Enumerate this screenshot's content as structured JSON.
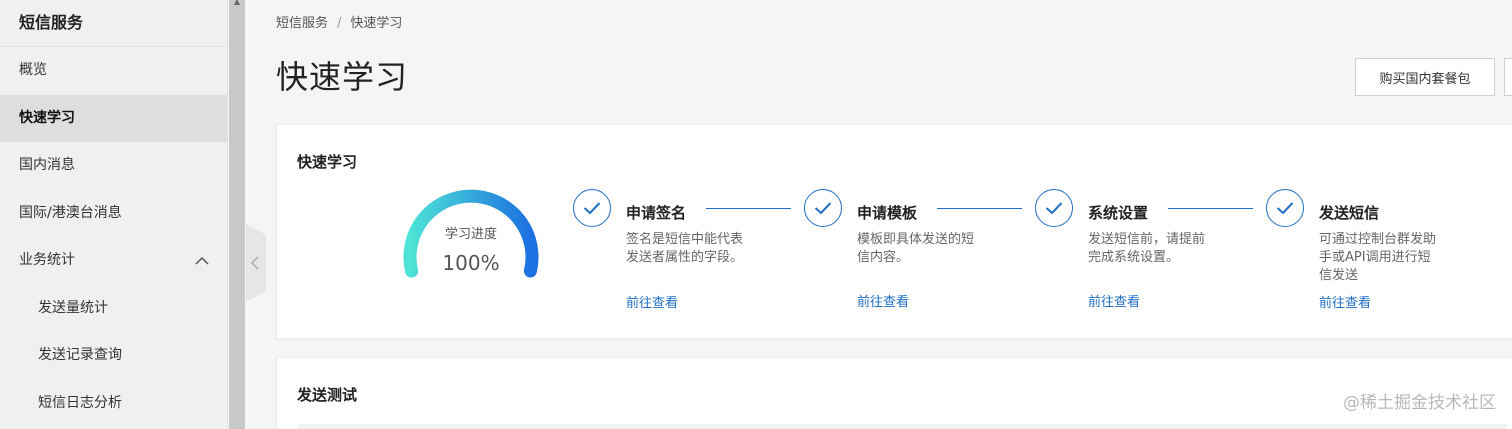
{
  "sidebar": {
    "title": "短信服务",
    "items": [
      {
        "label": "概览"
      },
      {
        "label": "快速学习"
      },
      {
        "label": "国内消息"
      },
      {
        "label": "国际/港澳台消息"
      },
      {
        "label": "业务统计"
      },
      {
        "label": "发送量统计"
      },
      {
        "label": "发送记录查询"
      },
      {
        "label": "短信日志分析"
      }
    ]
  },
  "breadcrumb": {
    "root": "短信服务",
    "separator": "/",
    "current": "快速学习"
  },
  "page": {
    "title": "快速学习",
    "buy_button": "购买国内套餐包"
  },
  "learn_card": {
    "title": "快速学习",
    "gauge": {
      "label": "学习进度",
      "value": "100%",
      "progress": 1.0
    },
    "steps": [
      {
        "title": "申请签名",
        "desc": "签名是短信中能代表发送者属性的字段。",
        "link": "前往查看"
      },
      {
        "title": "申请模板",
        "desc": "模板即具体发送的短信内容。",
        "link": "前往查看"
      },
      {
        "title": "系统设置",
        "desc": "发送短信前，请提前完成系统设置。",
        "link": "前往查看"
      },
      {
        "title": "发送短信",
        "desc": "可通过控制台群发助手或API调用进行短信发送",
        "link": "前往查看"
      }
    ]
  },
  "test_card": {
    "title": "发送测试"
  },
  "watermark": "@稀土掘金技术社区",
  "colors": {
    "accent": "#1f6fc5",
    "gauge_start": "#4de3d6",
    "gauge_end": "#1b6fe0"
  }
}
